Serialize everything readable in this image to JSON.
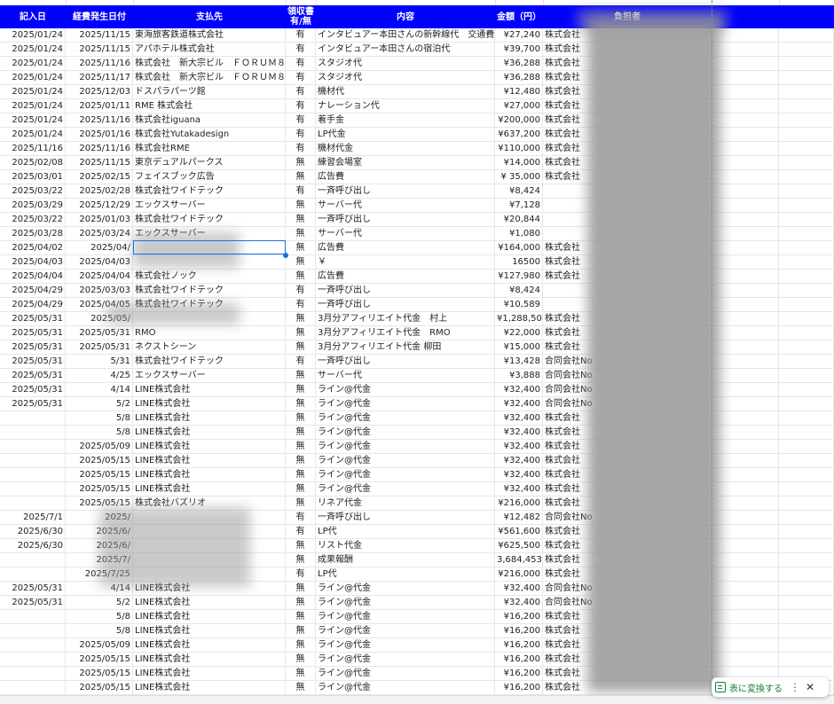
{
  "header": {
    "cols": [
      "記入日",
      "経費発生日付",
      "支払先",
      "領収書\n有/無",
      "内容",
      "金額（円）",
      "負担者"
    ]
  },
  "rows": [
    [
      "2025/01/24",
      "2025/11/15",
      "東海旅客鉄道株式会社",
      "有",
      "インタビュアー本田さんの新幹線代　交通費",
      "¥27,240",
      "株式会社"
    ],
    [
      "2025/01/24",
      "2025/11/15",
      "アパホテル株式会社",
      "有",
      "インタビュアー本田さんの宿泊代",
      "¥39,700",
      "株式会社"
    ],
    [
      "2025/01/24",
      "2025/11/16",
      "株式会社　新大宗ビル　ＦＯＲＵＭ８",
      "有",
      "スタジオ代",
      "¥36,288",
      "株式会社"
    ],
    [
      "2025/01/24",
      "2025/11/17",
      "株式会社　新大宗ビル　ＦＯＲＵＭ８",
      "有",
      "スタジオ代",
      "¥36,288",
      "株式会社"
    ],
    [
      "2025/01/24",
      "2025/12/03",
      "ドスパラパーツ館",
      "有",
      "機材代",
      "¥12,480",
      "株式会社"
    ],
    [
      "2025/01/24",
      "2025/01/11",
      "RME 株式会社",
      "有",
      "ナレーション代",
      "¥27,000",
      "株式会社"
    ],
    [
      "2025/01/24",
      "2025/11/16",
      "株式会社iguana",
      "有",
      "着手金",
      "¥200,000",
      "株式会社"
    ],
    [
      "2025/01/24",
      "2025/01/16",
      "株式会社Yutakadesign",
      "有",
      "LP代金",
      "¥637,200",
      "株式会社"
    ],
    [
      "2025/11/16",
      "2025/11/16",
      "株式会社RME",
      "有",
      "機材代金",
      "¥110,000",
      "株式会社"
    ],
    [
      "2025/02/08",
      "2025/11/15",
      "東京デュアルパークス",
      "無",
      "練習会場室",
      "¥14,000",
      "株式会社"
    ],
    [
      "2025/03/01",
      "2025/02/15",
      "フェイスブック広告",
      "無",
      "広告費",
      "¥ 35,000",
      "株式会社"
    ],
    [
      "2025/03/22",
      "2025/02/28",
      "株式会社ワイドテック",
      "有",
      "一斉呼び出し",
      "¥8,424",
      ""
    ],
    [
      "2025/03/29",
      "2025/12/29",
      "エックスサーバー",
      "無",
      "サーバー代",
      "¥7,128",
      ""
    ],
    [
      "2025/03/22",
      "2025/01/03",
      "株式会社ワイドテック",
      "無",
      "一斉呼び出し",
      "¥20,844",
      ""
    ],
    [
      "2025/03/28",
      "2025/03/24",
      "エックスサーバー",
      "無",
      "サーバー代",
      "¥1,080",
      ""
    ],
    [
      "2025/04/02",
      "2025/04/",
      "",
      "無",
      "広告費",
      "¥164,000",
      "株式会社"
    ],
    [
      "2025/04/03",
      "2025/04/03",
      "",
      "無",
      "￥",
      "16500",
      "株式会社"
    ],
    [
      "2025/04/04",
      "2025/04/04",
      "株式会社ノック",
      "無",
      "広告費",
      "¥127,980",
      "株式会社"
    ],
    [
      "2025/04/29",
      "2025/03/03",
      "株式会社ワイドテック",
      "有",
      "一斉呼び出し",
      "¥8,424",
      ""
    ],
    [
      "2025/04/29",
      "2025/04/05",
      "株式会社ワイドテック",
      "有",
      "一斉呼び出し",
      "¥10,589",
      ""
    ],
    [
      "2025/05/31",
      "2025/05/",
      "",
      "無",
      "3月分アフィリエイト代金　村上",
      "¥1,288,500",
      "株式会社"
    ],
    [
      "2025/05/31",
      "2025/05/31",
      "RMO",
      "無",
      "3月分アフィリエイト代金　RMO",
      "¥22,000",
      "株式会社"
    ],
    [
      "2025/05/31",
      "2025/05/31",
      "ネクストシーン",
      "無",
      "3月分アフィリエイト代金 柳田",
      "¥15,000",
      "株式会社"
    ],
    [
      "2025/05/31",
      "5/31",
      "株式会社ワイドテック",
      "有",
      "一斉呼び出し",
      "¥13,428",
      "合同会社No"
    ],
    [
      "2025/05/31",
      "4/25",
      "エックスサーバー",
      "無",
      "サーバー代",
      "¥3,888",
      "合同会社No"
    ],
    [
      "2025/05/31",
      "4/14",
      "LINE株式会社",
      "無",
      "ライン@代金",
      "¥32,400",
      "合同会社No"
    ],
    [
      "2025/05/31",
      "5/2",
      "LINE株式会社",
      "無",
      "ライン@代金",
      "¥32,400",
      "合同会社No"
    ],
    [
      "",
      "5/8",
      "LINE株式会社",
      "無",
      "ライン@代金",
      "¥32,400",
      "株式会社"
    ],
    [
      "",
      "5/8",
      "LINE株式会社",
      "無",
      "ライン@代金",
      "¥32,400",
      "株式会社"
    ],
    [
      "",
      "2025/05/09",
      "LINE株式会社",
      "無",
      "ライン@代金",
      "¥32,400",
      "株式会社"
    ],
    [
      "",
      "2025/05/15",
      "LINE株式会社",
      "無",
      "ライン@代金",
      "¥32,400",
      "株式会社"
    ],
    [
      "",
      "2025/05/15",
      "LINE株式会社",
      "無",
      "ライン@代金",
      "¥32,400",
      "株式会社"
    ],
    [
      "",
      "2025/05/15",
      "LINE株式会社",
      "無",
      "ライン@代金",
      "¥32,400",
      "株式会社"
    ],
    [
      "",
      "2025/05/15",
      "株式会社バズリオ",
      "無",
      "リネア代金",
      "¥216,000",
      "株式会社"
    ],
    [
      "2025/7/1",
      "2025/",
      "",
      "有",
      "一斉呼び出し",
      "¥12,482",
      "合同会社No"
    ],
    [
      "2025/6/30",
      "2025/6/",
      "",
      "有",
      "LP代",
      "¥561,600",
      "株式会社"
    ],
    [
      "2025/6/30",
      "2025/6/",
      "",
      "無",
      "リスト代金",
      "¥625,500",
      "株式会社"
    ],
    [
      "",
      "2025/7/",
      "",
      "無",
      "成果報酬",
      "3,684,453",
      "株式会社"
    ],
    [
      "",
      "2025/7/25",
      "",
      "有",
      "LP代",
      "¥216,000",
      "株式会社"
    ],
    [
      "2025/05/31",
      "4/14",
      "LINE株式会社",
      "無",
      "ライン@代金",
      "¥32,400",
      "合同会社No"
    ],
    [
      "2025/05/31",
      "5/2",
      "LINE株式会社",
      "無",
      "ライン@代金",
      "¥32,400",
      "合同会社No"
    ],
    [
      "",
      "5/8",
      "LINE株式会社",
      "無",
      "ライン@代金",
      "¥16,200",
      "株式会社"
    ],
    [
      "",
      "5/8",
      "LINE株式会社",
      "無",
      "ライン@代金",
      "¥16,200",
      "株式会社"
    ],
    [
      "",
      "2025/05/09",
      "LINE株式会社",
      "無",
      "ライン@代金",
      "¥16,200",
      "株式会社"
    ],
    [
      "",
      "2025/05/15",
      "LINE株式会社",
      "無",
      "ライン@代金",
      "¥16,200",
      "株式会社"
    ],
    [
      "",
      "2025/05/15",
      "LINE株式会社",
      "無",
      "ライン@代金",
      "¥16,200",
      "株式会社"
    ],
    [
      "",
      "2025/05/15",
      "LINE株式会社",
      "無",
      "ライン@代金",
      "¥16,200",
      "株式会社"
    ]
  ],
  "chip": {
    "label": "表に変換する",
    "more": "⋮",
    "close": "✕"
  },
  "icons": {
    "table": "table-icon"
  },
  "colors": {
    "header_bg": "#0000ff",
    "chip_text": "#188038",
    "selection": "#1a73e8"
  }
}
